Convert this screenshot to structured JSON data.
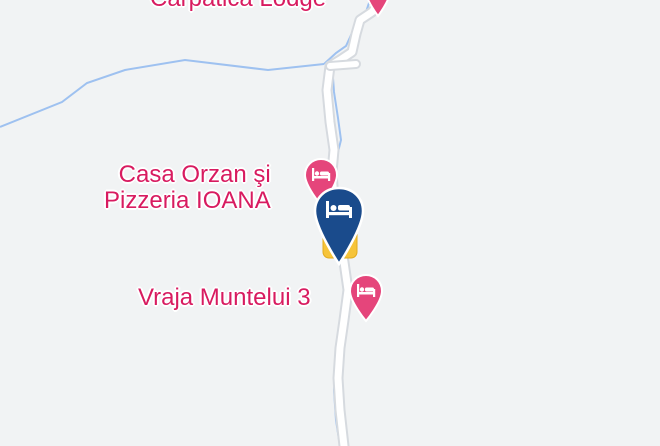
{
  "map": {
    "places": [
      {
        "id": "carpatica",
        "label": "Carpatica Lodge",
        "category": "hotel",
        "icon": "bed-icon"
      },
      {
        "id": "casa-orzan",
        "label_line1": "Casa Orzan şi",
        "label_line2": "Pizzeria IOANA",
        "category": "hotel",
        "icon": "bed-icon"
      },
      {
        "id": "vraja",
        "label": "Vraja Muntelui 3",
        "category": "hotel",
        "icon": "bed-icon"
      }
    ],
    "selected_marker": {
      "category": "hotel",
      "icon": "bed-icon",
      "color": "#1a4b8c"
    },
    "colors": {
      "background": "#f1f3f4",
      "river": "#9ec1f0",
      "road": "#ffffff",
      "road_casing": "#d6dadf",
      "poi": "#d81b60",
      "shield": "#f6c43a"
    }
  }
}
